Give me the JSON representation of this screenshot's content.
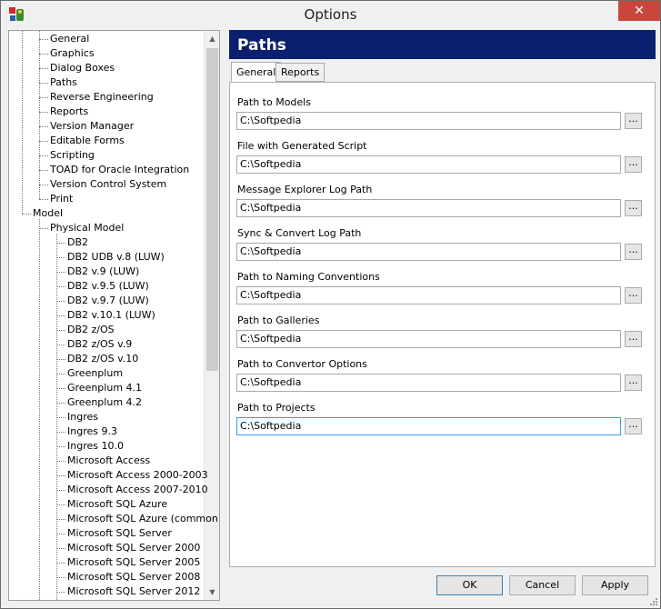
{
  "window": {
    "title": "Options",
    "close_glyph": "✕",
    "app_icon": "options-app-icon"
  },
  "tree": {
    "items": [
      {
        "label": "General",
        "level": 2
      },
      {
        "label": "Graphics",
        "level": 2
      },
      {
        "label": "Dialog Boxes",
        "level": 2
      },
      {
        "label": "Paths",
        "level": 2
      },
      {
        "label": "Reverse Engineering",
        "level": 2
      },
      {
        "label": "Reports",
        "level": 2
      },
      {
        "label": "Version Manager",
        "level": 2
      },
      {
        "label": "Editable Forms",
        "level": 2
      },
      {
        "label": "Scripting",
        "level": 2
      },
      {
        "label": "TOAD for Oracle Integration",
        "level": 2
      },
      {
        "label": "Version Control System",
        "level": 2
      },
      {
        "label": "Print",
        "level": 2
      },
      {
        "label": "Model",
        "level": 1
      },
      {
        "label": "Physical Model",
        "level": 2
      },
      {
        "label": "DB2",
        "level": 3
      },
      {
        "label": "DB2 UDB v.8 (LUW)",
        "level": 3
      },
      {
        "label": "DB2 v.9 (LUW)",
        "level": 3
      },
      {
        "label": "DB2 v.9.5 (LUW)",
        "level": 3
      },
      {
        "label": "DB2 v.9.7 (LUW)",
        "level": 3
      },
      {
        "label": "DB2 v.10.1 (LUW)",
        "level": 3
      },
      {
        "label": "DB2 z/OS",
        "level": 3
      },
      {
        "label": "DB2 z/OS v.9",
        "level": 3
      },
      {
        "label": "DB2 z/OS v.10",
        "level": 3
      },
      {
        "label": "Greenplum",
        "level": 3
      },
      {
        "label": "Greenplum 4.1",
        "level": 3
      },
      {
        "label": "Greenplum 4.2",
        "level": 3
      },
      {
        "label": "Ingres",
        "level": 3
      },
      {
        "label": "Ingres 9.3",
        "level": 3
      },
      {
        "label": "Ingres 10.0",
        "level": 3
      },
      {
        "label": "Microsoft Access",
        "level": 3
      },
      {
        "label": "Microsoft Access 2000-2003",
        "level": 3
      },
      {
        "label": "Microsoft Access 2007-2010",
        "level": 3
      },
      {
        "label": "Microsoft SQL Azure",
        "level": 3
      },
      {
        "label": "Microsoft SQL Azure (common)",
        "level": 3
      },
      {
        "label": "Microsoft SQL Server",
        "level": 3
      },
      {
        "label": "Microsoft SQL Server 2000",
        "level": 3
      },
      {
        "label": "Microsoft SQL Server 2005",
        "level": 3
      },
      {
        "label": "Microsoft SQL Server 2008",
        "level": 3
      },
      {
        "label": "Microsoft SQL Server 2012",
        "level": 3
      }
    ],
    "scroll_up_glyph": "▲",
    "scroll_down_glyph": "▼"
  },
  "panel": {
    "header": "Paths",
    "tabs": [
      {
        "label": "General",
        "active": true
      },
      {
        "label": "Reports",
        "active": false
      }
    ],
    "fields": [
      {
        "label": "Path to Models",
        "value": "C:\\Softpedia"
      },
      {
        "label": "File with Generated Script",
        "value": "C:\\Softpedia"
      },
      {
        "label": "Message Explorer Log Path",
        "value": "C:\\Softpedia"
      },
      {
        "label": "Sync & Convert Log Path",
        "value": "C:\\Softpedia"
      },
      {
        "label": "Path to Naming Conventions",
        "value": "C:\\Softpedia"
      },
      {
        "label": "Path to Galleries",
        "value": "C:\\Softpedia"
      },
      {
        "label": "Path to Convertor Options",
        "value": "C:\\Softpedia"
      },
      {
        "label": "Path to Projects",
        "value": "C:\\Softpedia"
      }
    ],
    "browse_label": "...",
    "header_color": "#0a1f6e"
  },
  "buttons": {
    "ok": "OK",
    "cancel": "Cancel",
    "apply": "Apply"
  }
}
